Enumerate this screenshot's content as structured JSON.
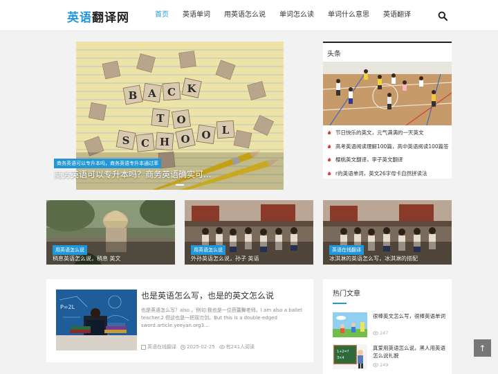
{
  "site": {
    "logo_a": "英语",
    "logo_b": "翻译网"
  },
  "nav": [
    {
      "label": "首页",
      "active": true
    },
    {
      "label": "英语单词"
    },
    {
      "label": "用英语怎么说"
    },
    {
      "label": "单词怎么读"
    },
    {
      "label": "单词什么意思"
    },
    {
      "label": "英语翻译"
    }
  ],
  "icons": {
    "search": "search-icon",
    "flame": "flame-icon",
    "clock": "clock-icon",
    "eye": "eye-icon",
    "category": "category-icon",
    "arrow_up": "arrow-up-icon"
  },
  "colors": {
    "accent": "#2196d8",
    "flame": "#e03a2f"
  },
  "hero": {
    "tag": "商务英语可以专升本吗，商务英语专升本通过率",
    "title": "商务英语可以专升本吗？商务英语确实可..."
  },
  "headline": {
    "title": "头条",
    "items": [
      "节日快乐的英文，元气满满的一天英文",
      "高考英语阅读理解100篇，高中英语阅读100篇答",
      "樱桃英文翻译，李子英文翻译",
      "r的英语单词，英文26字母卡自然拼读法"
    ]
  },
  "cards": [
    {
      "tag": "用英语怎么说",
      "title": "稍息英语怎么说，稍息 英文"
    },
    {
      "tag": "用英语怎么说",
      "title": "外孙英语怎么说，孙子 英语"
    },
    {
      "tag": "英语在线翻译",
      "title": "冰淇淋的英语怎么写，冰淇淋的搭配"
    }
  ],
  "article": {
    "title": "也是英语怎么写，也是的英文怎么说",
    "desc": "也是英语怎么写？also 。例句:我也是一位芭蕾舞老师。I am also a ballet teacher.2 但这也是一把双刃剑。But this is a double-edged sword.article.yeeyan.org3...",
    "category": "英语在线翻译",
    "date": "2025-02-25",
    "views": "有241人阅读"
  },
  "hot": {
    "title": "热门文章",
    "items": [
      {
        "title": "很棒英文怎么写，很棒英语单词",
        "views": "247"
      },
      {
        "title": "真爱用英语怎么说，黑人用英语怎么说礼貌",
        "views": "249"
      }
    ]
  },
  "totop": {
    "label": "↑"
  }
}
